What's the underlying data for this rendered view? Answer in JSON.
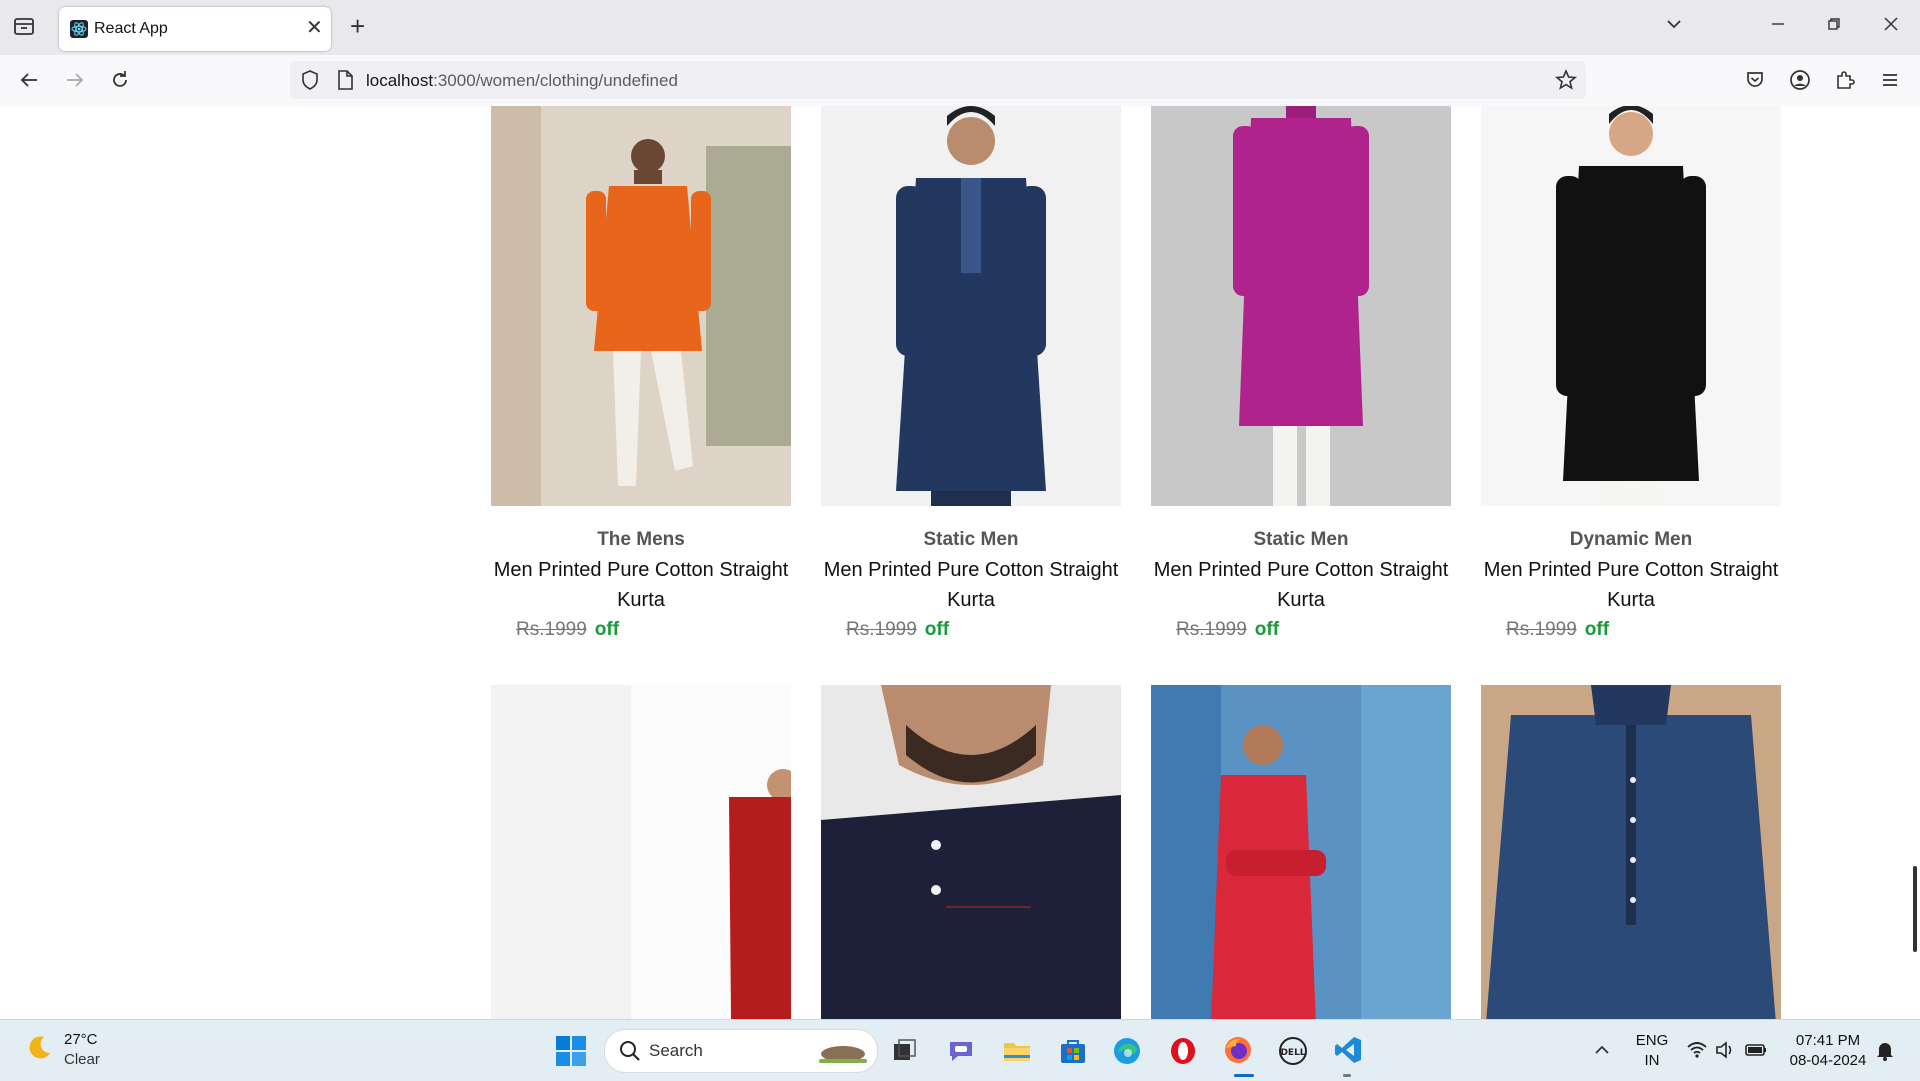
{
  "browser": {
    "tab_title": "React App",
    "tab_close": "✕",
    "new_tab": "+",
    "url_host": "localhost",
    "url_rest": ":3000/women/clothing/undefined"
  },
  "products": [
    {
      "brand": "The Mens",
      "name": "Men Printed Pure Cotton Straight Kurta",
      "price": "Rs.1999",
      "off": "off",
      "kurta_color": "#e8651c",
      "bg": "#ddd3c6"
    },
    {
      "brand": "Static Men",
      "name": "Men Printed Pure Cotton Straight Kurta",
      "price": "Rs.1999",
      "off": "off",
      "kurta_color": "#23385e",
      "bg": "#f1f1f1"
    },
    {
      "brand": "Static Men",
      "name": "Men Printed Pure Cotton Straight Kurta",
      "price": "Rs.1999",
      "off": "off",
      "kurta_color": "#b0238c",
      "bg": "#c8c8c8"
    },
    {
      "brand": "Dynamic Men",
      "name": "Men Printed Pure Cotton Straight Kurta",
      "price": "Rs.1999",
      "off": "off",
      "kurta_color": "#111111",
      "bg": "#f6f6f6"
    },
    {
      "kurta_color": "#b51d1d",
      "bg": "#fbfbfb"
    },
    {
      "kurta_color": "#1d2038",
      "bg": "#e9e9e9"
    },
    {
      "kurta_color": "#d8283a",
      "bg": "#5a92c4"
    },
    {
      "kurta_color": "#2c4a78",
      "bg": "#c9a786"
    }
  ],
  "taskbar": {
    "temp": "27°C",
    "weather": "Clear",
    "search_label": "Search",
    "lang_top": "ENG",
    "lang_bottom": "IN",
    "time": "07:41 PM",
    "date": "08-04-2024"
  },
  "icons": {
    "tab_list": "tab-list-icon",
    "back": "back-arrow-icon",
    "forward": "forward-arrow-icon",
    "reload": "reload-icon",
    "shield": "shield-icon",
    "page": "page-icon",
    "star": "bookmark-star-icon",
    "pocket": "pocket-icon",
    "account": "account-icon",
    "extensions": "extensions-icon",
    "menu": "hamburger-menu-icon"
  }
}
